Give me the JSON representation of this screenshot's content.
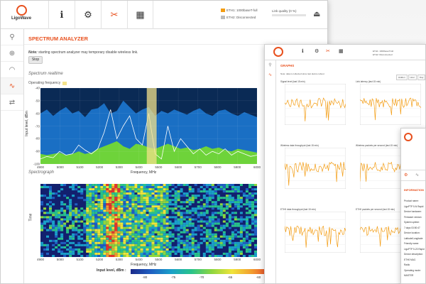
{
  "main_window": {
    "logo": "LigoWave",
    "nav": [
      {
        "icon": "info-icon",
        "glyph": "ℹ"
      },
      {
        "icon": "gear-icon",
        "glyph": "⚙"
      },
      {
        "icon": "tools-icon",
        "glyph": "✂"
      },
      {
        "icon": "monitor-icon",
        "glyph": "▦"
      }
    ],
    "eth1": "ETH1: 1000baseT-full",
    "eth2": "ETH2: Disconnected",
    "link_quality": "Link quality (0 %)",
    "sidebar": [
      {
        "icon": "search-icon",
        "glyph": "⚲"
      },
      {
        "icon": "globe-icon",
        "glyph": "⊕"
      },
      {
        "icon": "gauge-icon",
        "glyph": "◠"
      },
      {
        "icon": "chart-icon",
        "glyph": "∿"
      },
      {
        "icon": "sliders-icon",
        "glyph": "⇄"
      }
    ],
    "page_title": "SPECTRUM ANALYZER",
    "note_label": "Note:",
    "note_text": " starting spectrum analyzer may temporary disable wireless link.",
    "stop_label": "Stop",
    "realtime_title": "Spectrum realtime",
    "operating_frequency": "Operating frequency",
    "spectrograph_title": "Spectrograph",
    "input_level_label": "Input level, dBm :",
    "colorscale_ticks": [
      "-80",
      "-75",
      "-70",
      "-65",
      "-60"
    ]
  },
  "chart_data": [
    {
      "type": "area",
      "title": "Spectrum realtime",
      "xlabel": "Frequency, MHz",
      "ylabel": "Input level, dBm",
      "x_ticks": [
        "4900",
        "5000",
        "5100",
        "5200",
        "5300",
        "5400",
        "5500",
        "5600",
        "5700",
        "5800",
        "5900",
        "6000"
      ],
      "y_ticks": [
        "-40",
        "-50",
        "-60",
        "-70",
        "-80",
        "-90",
        "-100"
      ],
      "xlim": [
        4900,
        6000
      ],
      "ylim": [
        -100,
        -40
      ],
      "operating_band": [
        5440,
        5490
      ],
      "series": [
        {
          "color": "#1a6fc4",
          "values": [
            -60,
            -57,
            -62,
            -58,
            -55,
            -60,
            -58,
            -63,
            -57,
            -56,
            -52,
            -60,
            -58,
            -50,
            -55,
            -60,
            -57,
            -55,
            -62,
            -58,
            -60,
            -57,
            -59,
            -61,
            -58,
            -56,
            -60,
            -62,
            -58,
            -57,
            -60,
            -62,
            -59,
            -61,
            -63
          ]
        },
        {
          "color": "#6ed33a",
          "values": [
            -92,
            -93,
            -92,
            -91,
            -93,
            -92,
            -90,
            -92,
            -91,
            -88,
            -86,
            -84,
            -82,
            -86,
            -88,
            -84,
            -85,
            -87,
            -88,
            -86,
            -84,
            -86,
            -88,
            -87,
            -89,
            -88,
            -86,
            -88,
            -87,
            -89,
            -90,
            -88,
            -89,
            -90,
            -91
          ]
        },
        {
          "color": "#ffffff",
          "values": [
            -96,
            -94,
            -95,
            -90,
            -93,
            -92,
            -85,
            -89,
            -92,
            -88,
            -75,
            -57,
            -80,
            -70,
            -62,
            -80,
            -85,
            -60,
            -92,
            -96,
            -70,
            -90,
            -80,
            -86,
            -92,
            -88,
            -93,
            -90,
            -92,
            -88,
            -93,
            -90,
            -92,
            -94,
            -93
          ]
        }
      ]
    },
    {
      "type": "heatmap",
      "title": "Spectrograph",
      "xlabel": "Frequency, MHz",
      "ylabel": "Time",
      "x_ticks": [
        "4900",
        "5000",
        "5100",
        "5200",
        "5300",
        "5400",
        "5500",
        "5600",
        "5700",
        "5800",
        "5900",
        "6000"
      ],
      "xlim": [
        4900,
        6000
      ],
      "zlim": [
        -80,
        -60
      ]
    }
  ],
  "graphs_window": {
    "title": "GRAPHS",
    "note": "Note: data is collected since last device reboot",
    "tabs": [
      "Hidden",
      "Hour",
      "Day",
      "Wk"
    ],
    "charts": [
      {
        "title": "Signal level (last 15 min)"
      },
      {
        "title": "Link latency (last 15 min)"
      },
      {
        "title": "Wireless data throughput (last 15 min)"
      },
      {
        "title": "Wireless packets per second (last 15 min)"
      },
      {
        "title": "ETH0 data throughput (last 15 min)"
      },
      {
        "title": "ETH0 packets per second (last 15 min)"
      }
    ]
  },
  "info_window": {
    "title": "INFORMATION",
    "lines": [
      "Product name:",
      "LigoPTP 5-N Rapid",
      "Device hardware:",
      "Firmware version:",
      "System uptime:",
      "7 days 03:50:47",
      "Device location:",
      "Latitude/Longitude:",
      "Friendly name:",
      "LigoPTP 5-23 Rapid",
      "Device description:",
      "ETH0 MAC:",
      "Radio",
      "Operating mode:",
      "MASTER"
    ]
  }
}
